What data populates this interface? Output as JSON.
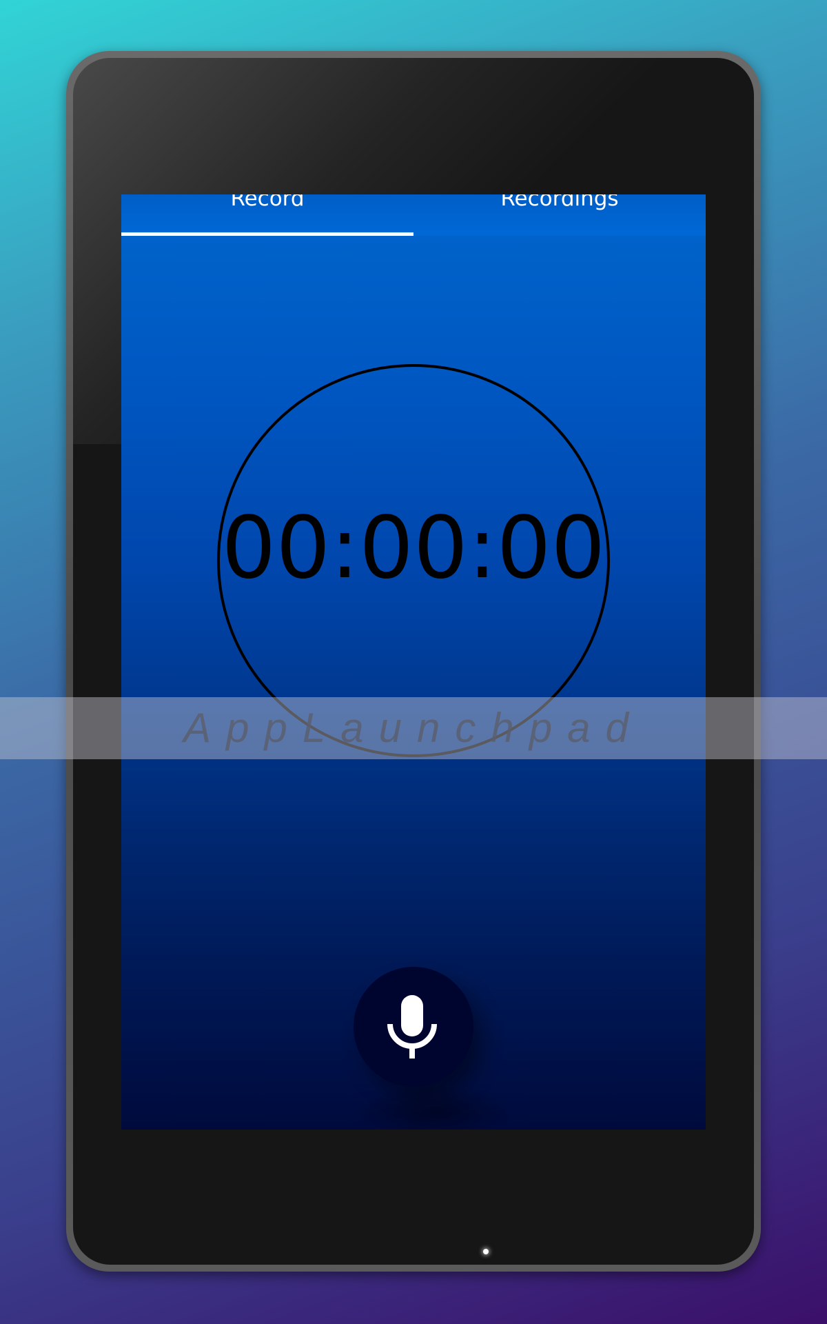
{
  "tabs": [
    {
      "label": "Record",
      "selected": true
    },
    {
      "label": "Recordings",
      "selected": false
    }
  ],
  "timer": {
    "display": "00:00:00"
  },
  "record_button": {
    "icon": "microphone-icon"
  },
  "watermark": {
    "text": "AppLaunchpad"
  },
  "colors": {
    "tab_bar": "#0066cc",
    "screen_top": "#0066cc",
    "screen_bottom": "#000a3c",
    "record_button": "#000530",
    "indicator": "#ffffff"
  }
}
